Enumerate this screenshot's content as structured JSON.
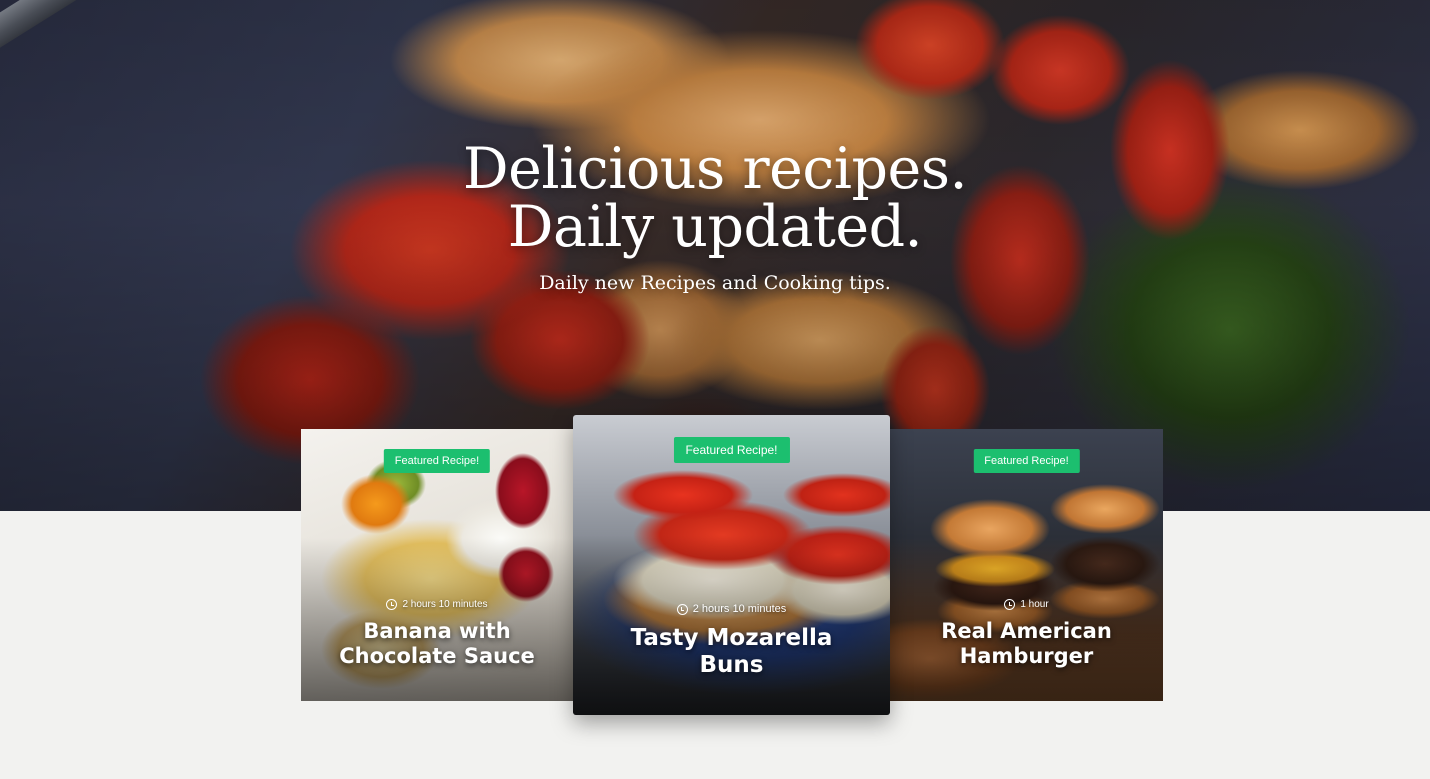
{
  "hero": {
    "title_line1": "Delicious recipes.",
    "title_line2": "Daily updated.",
    "subtitle": "Daily new Recipes and Cooking tips."
  },
  "cards": [
    {
      "badge": "Featured Recipe!",
      "time": "2 hours 10 minutes",
      "title_line1": "Banana with",
      "title_line2": "Chocolate Sauce"
    },
    {
      "badge": "Featured Recipe!",
      "time": "2 hours 10 minutes",
      "title_line1": "Tasty Mozarella",
      "title_line2": "Buns"
    },
    {
      "badge": "Featured Recipe!",
      "time": "1 hour",
      "title_line1": "Real American",
      "title_line2": "Hamburger"
    }
  ],
  "colors": {
    "badge_bg": "#1cbf6f",
    "page_bg": "#f2f2f0",
    "text_on_image": "#ffffff"
  },
  "icons": {
    "time": "clock-icon"
  }
}
